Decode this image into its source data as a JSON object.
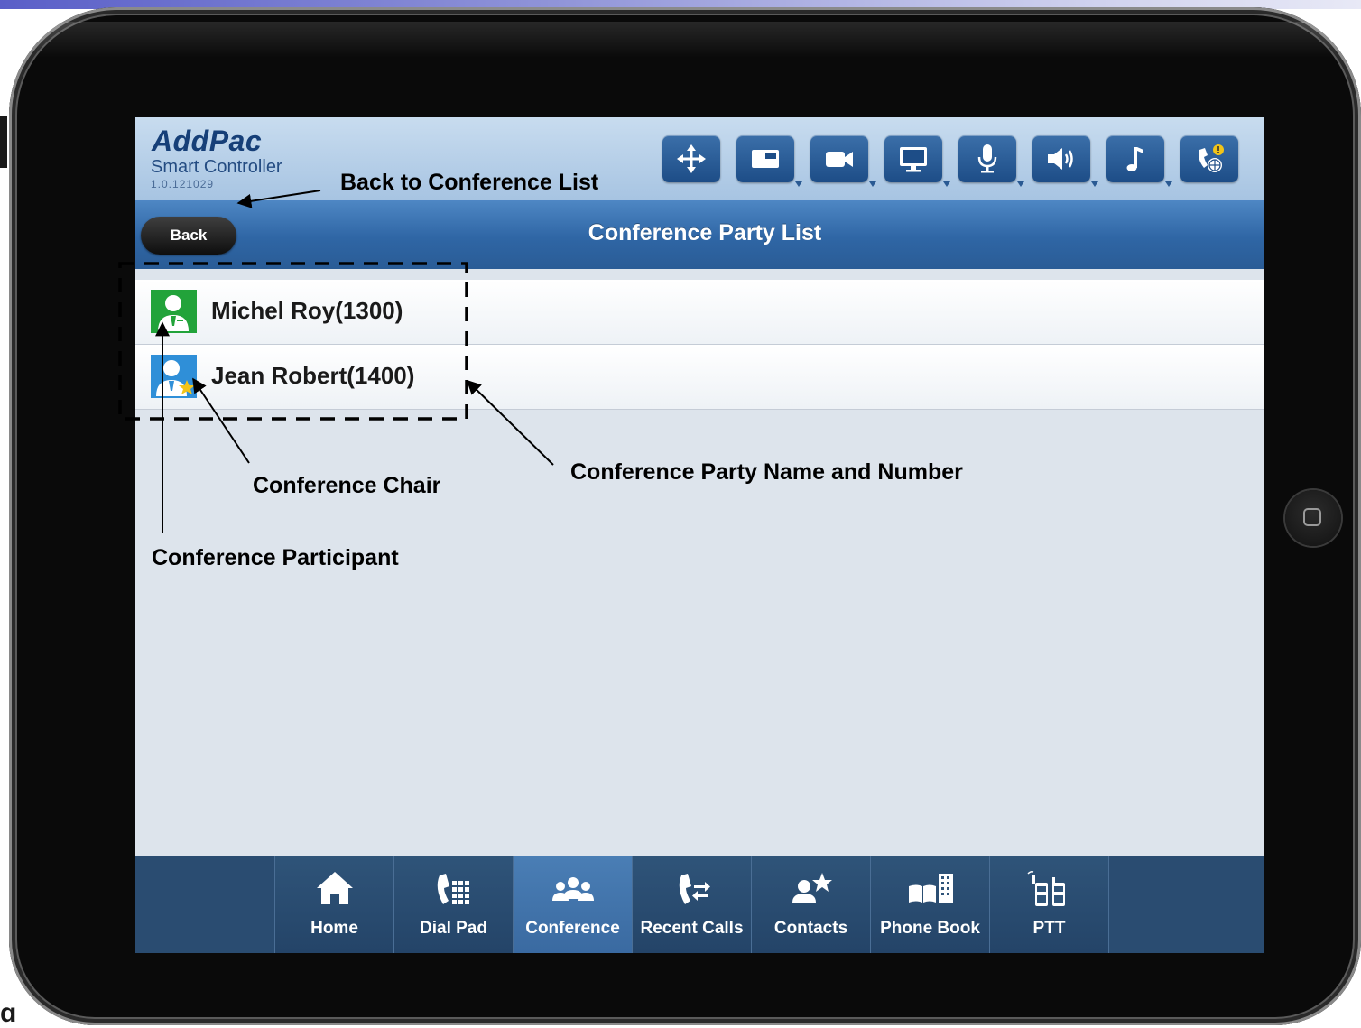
{
  "app": {
    "logo": "AddPac",
    "subtitle": "Smart Controller",
    "version": "1.0.121029"
  },
  "toolbar": [
    {
      "icon": "move-arrows-icon"
    },
    {
      "icon": "window-icon"
    },
    {
      "icon": "camera-icon"
    },
    {
      "icon": "monitor-icon"
    },
    {
      "icon": "microphone-icon"
    },
    {
      "icon": "speaker-icon"
    },
    {
      "icon": "music-note-icon"
    },
    {
      "icon": "phone-globe-icon"
    }
  ],
  "titlebar": {
    "back_label": "Back",
    "title": "Conference Party List"
  },
  "parties": [
    {
      "name": "Michel Roy(1300)",
      "role": "participant",
      "avatar_color": "#22a33a"
    },
    {
      "name": "Jean Robert(1400)",
      "role": "chair",
      "avatar_color": "#2f8fd8"
    }
  ],
  "tabs": [
    {
      "label": "Home",
      "icon": "home-icon",
      "active": false
    },
    {
      "label": "Dial Pad",
      "icon": "dial-pad-icon",
      "active": false
    },
    {
      "label": "Conference",
      "icon": "conference-icon",
      "active": true
    },
    {
      "label": "Recent Calls",
      "icon": "recent-calls-icon",
      "active": false
    },
    {
      "label": "Contacts",
      "icon": "contacts-icon",
      "active": false
    },
    {
      "label": "Phone Book",
      "icon": "phone-book-icon",
      "active": false
    },
    {
      "label": "PTT",
      "icon": "ptt-icon",
      "active": false
    }
  ],
  "annotations": {
    "back_to_list": "Back to Conference List",
    "party_name_number": "Conference Party Name and Number",
    "chair": "Conference Chair",
    "participant": "Conference Participant"
  },
  "colors": {
    "header_bg": "#b9d2ea",
    "titlebar_bg": "#2f66a5",
    "bottombar_bg": "#2a4c71",
    "active_tab": "#4a7eb5"
  }
}
